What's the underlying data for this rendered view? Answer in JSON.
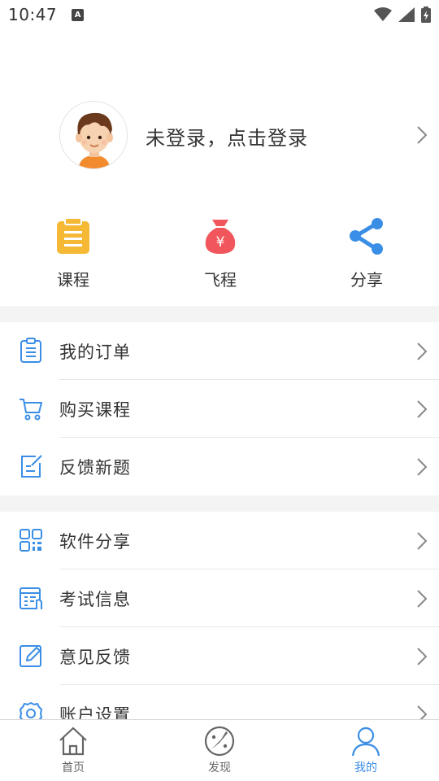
{
  "status_bar": {
    "time": "10:47",
    "notification_letter": "A"
  },
  "profile": {
    "login_prompt": "未登录，点击登录"
  },
  "quick_actions": [
    {
      "label": "课程",
      "icon": "clipboard-icon",
      "color": "#f5b936"
    },
    {
      "label": "飞程",
      "icon": "money-bag-icon",
      "color": "#f0565b"
    },
    {
      "label": "分享",
      "icon": "share-icon",
      "color": "#3a8ee6"
    }
  ],
  "menu_group_1": [
    {
      "label": "我的订单",
      "icon": "order-list-icon"
    },
    {
      "label": "购买课程",
      "icon": "shopping-cart-icon"
    },
    {
      "label": "反馈新题",
      "icon": "edit-note-icon"
    }
  ],
  "menu_group_2": [
    {
      "label": "软件分享",
      "icon": "qr-code-icon"
    },
    {
      "label": "考试信息",
      "icon": "calendar-list-icon"
    },
    {
      "label": "意见反馈",
      "icon": "pencil-edit-icon"
    },
    {
      "label": "账户设置",
      "icon": "gear-icon"
    }
  ],
  "tab_bar": [
    {
      "label": "首页",
      "icon": "home-icon",
      "active": false
    },
    {
      "label": "发现",
      "icon": "compass-icon",
      "active": false
    },
    {
      "label": "我的",
      "icon": "user-icon",
      "active": true
    }
  ],
  "colors": {
    "accent": "#3a8ee6",
    "divider": "#e8e8e8",
    "section_gap": "#f4f4f4"
  }
}
